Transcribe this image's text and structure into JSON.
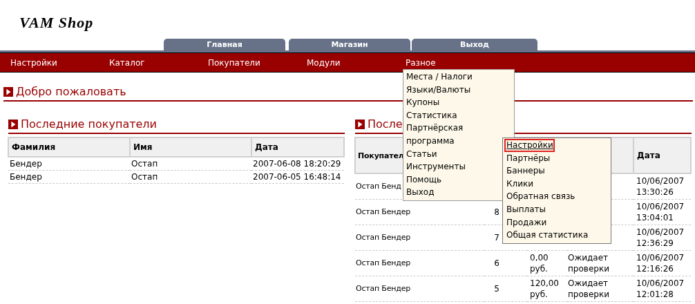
{
  "logo": "VAM Shop",
  "tabs": [
    {
      "label": "Главная"
    },
    {
      "label": "Магазин"
    },
    {
      "label": "Выход"
    }
  ],
  "nav": {
    "items": [
      {
        "label": "Настройки"
      },
      {
        "label": "Каталог"
      },
      {
        "label": "Покупатели"
      },
      {
        "label": "Модули"
      },
      {
        "label": "Разное",
        "expanded": true,
        "menu": [
          {
            "label": "Места / Налоги"
          },
          {
            "label": "Языки/Валюты"
          },
          {
            "label": "Купоны"
          },
          {
            "label": "Статистика"
          },
          {
            "label": "Партнёрская программа",
            "expanded": true,
            "children": [
              {
                "label": "Настройки",
                "selected": true
              },
              {
                "label": "Партнёры",
                "selected": false
              },
              {
                "label": "Баннеры",
                "selected": false
              },
              {
                "label": "Клики",
                "selected": false
              },
              {
                "label": "Обратная связь",
                "selected": false
              },
              {
                "label": "Выплаты",
                "selected": false
              },
              {
                "label": "Продажи",
                "selected": false
              },
              {
                "label": "Общая статистика",
                "selected": false
              }
            ]
          },
          {
            "label": "Статьи"
          },
          {
            "label": "Инструменты"
          },
          {
            "label": "Помощь"
          },
          {
            "label": "Выход"
          }
        ]
      }
    ]
  },
  "welcome": {
    "title": "Добро пожаловать"
  },
  "customers": {
    "title": "Последние покупатели",
    "columns": [
      "Фамилия",
      "Имя",
      "Дата"
    ],
    "rows": [
      [
        "Бендер",
        "Остап",
        "2007-06-08 18:20:29"
      ],
      [
        "Бендер",
        "Остап",
        "2007-06-05 16:48:14"
      ]
    ]
  },
  "orders": {
    "title": "После",
    "columns": [
      "Покупател",
      null,
      null,
      null,
      "Дата"
    ],
    "rows": [
      [
        "Остап Бенд",
        null,
        null,
        null,
        "10/06/2007 13:30:26"
      ],
      [
        "Остап Бендер",
        "8",
        null,
        null,
        "10/06/2007 13:04:01"
      ],
      [
        "Остап Бендер",
        "7",
        null,
        null,
        "10/06/2007 12:36:29"
      ],
      [
        "Остап Бендер",
        "6",
        "0,00 руб.",
        "Ожидает проверки",
        "10/06/2007 12:16:26"
      ],
      [
        "Остап Бендер",
        "5",
        "120,00 руб.",
        "Ожидает проверки",
        "10/06/2007 12:01:28"
      ]
    ]
  }
}
